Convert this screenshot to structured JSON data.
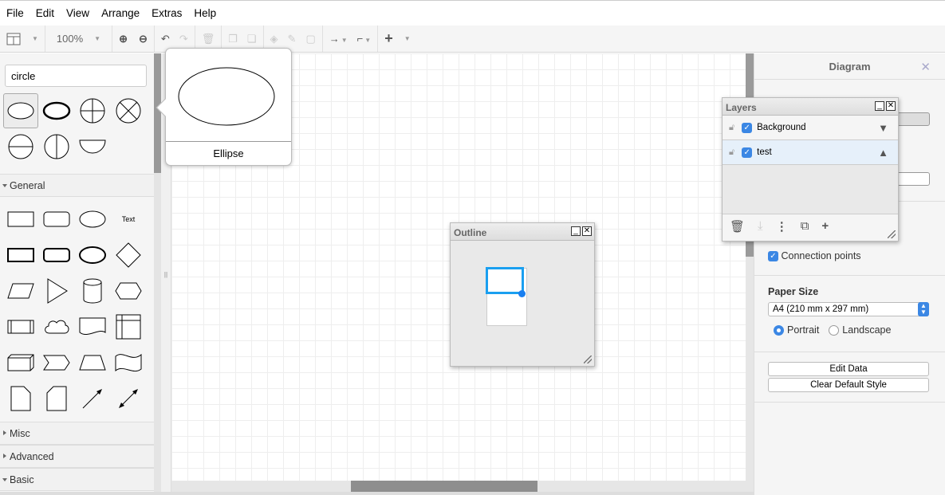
{
  "menu": [
    "File",
    "Edit",
    "View",
    "Arrange",
    "Extras",
    "Help"
  ],
  "toolbar": {
    "zoom": "100%"
  },
  "sidebar": {
    "search_value": "circle",
    "sections": {
      "general": "General",
      "misc": "Misc",
      "advanced": "Advanced",
      "basic": "Basic"
    },
    "text_shape": "Text"
  },
  "popup": {
    "label": "Ellipse"
  },
  "outline": {
    "title": "Outline"
  },
  "layers": {
    "title": "Layers",
    "items": [
      {
        "name": "Background",
        "visible": true,
        "move": "down"
      },
      {
        "name": "test",
        "visible": true,
        "move": "up",
        "selected": true
      }
    ]
  },
  "format": {
    "title": "Diagram",
    "connection_points": "Connection points",
    "paper_size_label": "Paper Size",
    "paper_size": "A4 (210 mm x 297 mm)",
    "portrait": "Portrait",
    "landscape": "Landscape",
    "orientation": "portrait",
    "edit_data": "Edit Data",
    "clear_default_style": "Clear Default Style"
  },
  "colors": {
    "accent": "#3b87e4",
    "selection": "#1a9ff0"
  }
}
